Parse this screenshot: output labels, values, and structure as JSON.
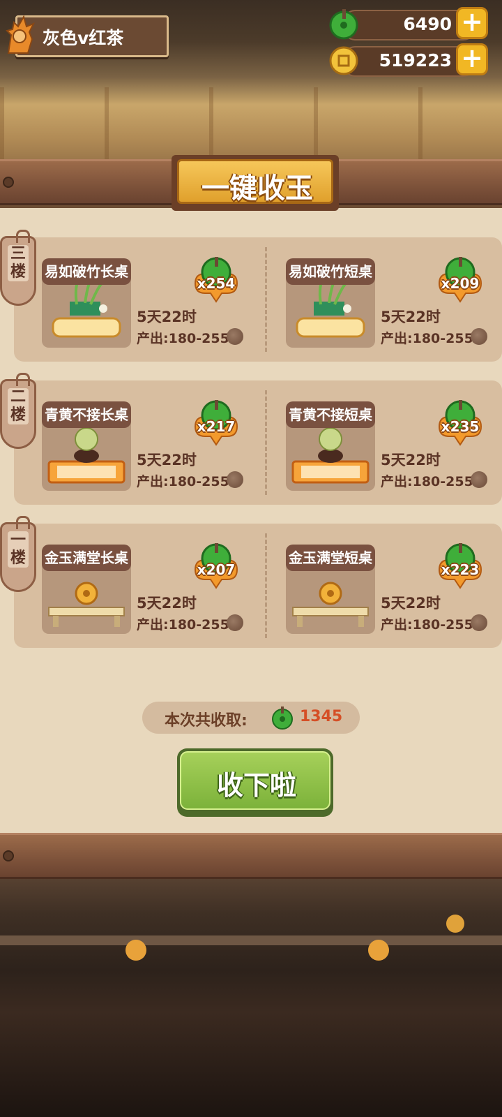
{
  "player": {
    "name": "灰色v红茶"
  },
  "currencies": [
    {
      "name": "jade",
      "value": "6490",
      "icon": "jade-icon"
    },
    {
      "name": "coin",
      "value": "519223",
      "icon": "coin-icon"
    }
  ],
  "title": "一键收玉",
  "floors": [
    {
      "tag": "三楼",
      "tables": [
        {
          "name": "易如破竹长桌",
          "count": "x254",
          "timer": "5天22时",
          "output": "产出:180-255",
          "art": "bamboo"
        },
        {
          "name": "易如破竹短桌",
          "count": "x209",
          "timer": "5天22时",
          "output": "产出:180-255",
          "art": "bamboo"
        }
      ]
    },
    {
      "tag": "二楼",
      "tables": [
        {
          "name": "青黄不接长桌",
          "count": "x217",
          "timer": "5天22时",
          "output": "产出:180-255",
          "art": "jade-orb"
        },
        {
          "name": "青黄不接短桌",
          "count": "x235",
          "timer": "5天22时",
          "output": "产出:180-255",
          "art": "jade-orb"
        }
      ]
    },
    {
      "tag": "一楼",
      "tables": [
        {
          "name": "金玉满堂长桌",
          "count": "x207",
          "timer": "5天22时",
          "output": "产出:180-255",
          "art": "gold-disc"
        },
        {
          "name": "金玉满堂短桌",
          "count": "x223",
          "timer": "5天22时",
          "output": "产出:180-255",
          "art": "gold-disc"
        }
      ]
    }
  ],
  "total": {
    "label": "本次共收取:",
    "value": "1345"
  },
  "collect_button": "收下啦",
  "colors": {
    "jade": "#3fae3a",
    "accent": "#d54f26",
    "button": "#8cc446"
  }
}
